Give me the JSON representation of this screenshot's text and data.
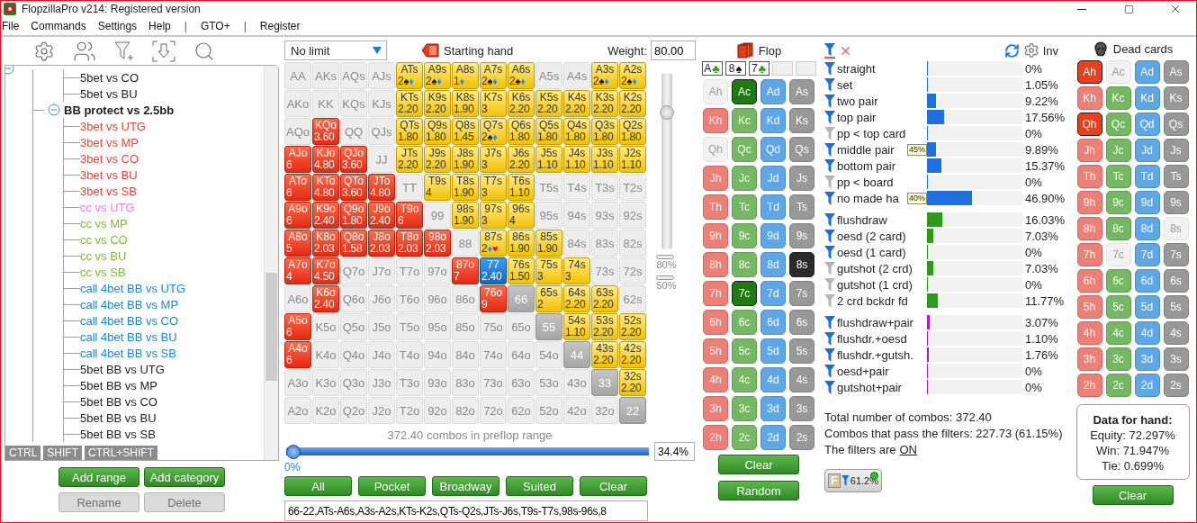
{
  "window": {
    "title": "FlopzillaPro v214: Registered version"
  },
  "menu": [
    {
      "label": "File",
      "kind": "item"
    },
    {
      "label": "Commands",
      "kind": "item"
    },
    {
      "label": "Settings",
      "kind": "item"
    },
    {
      "label": "Help",
      "kind": "item"
    },
    {
      "label": "|",
      "kind": "separator"
    },
    {
      "label": "GTO+",
      "kind": "item"
    },
    {
      "label": "|",
      "kind": "separator"
    },
    {
      "label": "Register",
      "kind": "item"
    }
  ],
  "tree": {
    "expanded": true,
    "items": [
      {
        "kind": "continued",
        "children": [
          {
            "label": "5bet vs CO",
            "color": "#222222"
          },
          {
            "label": "5bet vs BU",
            "color": "#222222"
          }
        ]
      },
      {
        "kind": "group",
        "label": "BB protect vs 2.5bb",
        "expanded": true,
        "children": [
          {
            "label": "3bet vs UTG",
            "color": "#e8453c"
          },
          {
            "label": "3bet vs MP",
            "color": "#e8453c"
          },
          {
            "label": "3bet vs CO",
            "color": "#e8453c"
          },
          {
            "label": "3bet vs BU",
            "color": "#e8453c"
          },
          {
            "label": "3bet vs SB",
            "color": "#e8453c"
          },
          {
            "label": "cc vs UTG",
            "color": "#f07df0"
          },
          {
            "label": "cc vs MP",
            "color": "#7dbb3c"
          },
          {
            "label": "cc vs CO",
            "color": "#7dbb3c"
          },
          {
            "label": "cc vs BU",
            "color": "#7dbb3c"
          },
          {
            "label": "cc vs SB",
            "color": "#7dbb3c"
          },
          {
            "label": "call 4bet BB vs UTG",
            "color": "#1d86d1"
          },
          {
            "label": "call 4bet BB vs MP",
            "color": "#1d86d1"
          },
          {
            "label": "call 4bet BB vs CO",
            "color": "#1d86d1"
          },
          {
            "label": "call 4bet BB vs BU",
            "color": "#1d86d1"
          },
          {
            "label": "call 4bet BB vs SB",
            "color": "#1d86d1"
          },
          {
            "label": "5bet BB vs UTG",
            "color": "#222222"
          },
          {
            "label": "5bet BB vs MP",
            "color": "#222222"
          },
          {
            "label": "5bet BB vs CO",
            "color": "#222222"
          },
          {
            "label": "5bet BB vs BU",
            "color": "#222222"
          },
          {
            "label": "5bet BB vs SB",
            "color": "#222222"
          }
        ]
      }
    ]
  },
  "modifier_keys": [
    "CTRL",
    "SHIFT",
    "CTRL+SHIFT"
  ],
  "range_buttons": [
    {
      "label": "Add range",
      "disabled": false
    },
    {
      "label": "Add category",
      "disabled": false
    },
    {
      "label": "Rename",
      "disabled": true
    },
    {
      "label": "Delete",
      "disabled": true
    }
  ],
  "range_editor": {
    "game_type": "No limit",
    "mode_label": "Starting hand",
    "weight_label": "Weight:",
    "weight": "80.00",
    "weight_slider": {
      "level": 0.8
    },
    "markers": [
      "80%",
      "50%"
    ],
    "grid": [
      [
        {
          "label": "AA",
          "kind": "empty"
        },
        {
          "label": "AKs",
          "kind": "empty"
        },
        {
          "label": "AQs",
          "kind": "empty"
        },
        {
          "label": "AJs",
          "kind": "empty"
        },
        {
          "label": "ATs",
          "kind": "suited",
          "value": "2",
          "suits": [
            {
              "symbol": "♠",
              "color": "#111111"
            },
            {
              "symbol": "♦",
              "color": "#1e90ff"
            }
          ]
        },
        {
          "label": "A9s",
          "kind": "suited",
          "value": "2",
          "suits": [
            {
              "symbol": "♠",
              "color": "#111111"
            },
            {
              "symbol": "♦",
              "color": "#1e90ff"
            }
          ]
        },
        {
          "label": "A8s",
          "kind": "suited",
          "value": "1",
          "suits": [
            {
              "symbol": "♦",
              "color": "#1e90ff"
            }
          ]
        },
        {
          "label": "A7s",
          "kind": "suited",
          "value": "2",
          "suits": [
            {
              "symbol": "♠",
              "color": "#111111"
            },
            {
              "symbol": "♦",
              "color": "#1e90ff"
            }
          ]
        },
        {
          "label": "A6s",
          "kind": "suited",
          "value": "2",
          "suits": [
            {
              "symbol": "♠",
              "color": "#111111"
            },
            {
              "symbol": "♦",
              "color": "#1e90ff"
            }
          ]
        },
        {
          "label": "A5s",
          "kind": "empty"
        },
        {
          "label": "A4s",
          "kind": "empty"
        },
        {
          "label": "A3s",
          "kind": "suited",
          "value": "2",
          "suits": [
            {
              "symbol": "♠",
              "color": "#111111"
            },
            {
              "symbol": "♦",
              "color": "#1e90ff"
            }
          ]
        },
        {
          "label": "A2s",
          "kind": "suited",
          "value": "2",
          "suits": [
            {
              "symbol": "♠",
              "color": "#111111"
            },
            {
              "symbol": "♦",
              "color": "#1e90ff"
            }
          ]
        }
      ],
      [
        {
          "label": "AKo",
          "kind": "empty"
        },
        {
          "label": "KK",
          "kind": "empty"
        },
        {
          "label": "KQs",
          "kind": "empty"
        },
        {
          "label": "KJs",
          "kind": "empty"
        },
        {
          "label": "KTs",
          "kind": "suited",
          "value": "2.20"
        },
        {
          "label": "K9s",
          "kind": "suited",
          "value": "2.20"
        },
        {
          "label": "K8s",
          "kind": "suited",
          "value": "1.90"
        },
        {
          "label": "K7s",
          "kind": "suited",
          "value": "3"
        },
        {
          "label": "K6s",
          "kind": "suited",
          "value": "2.20"
        },
        {
          "label": "K5s",
          "kind": "suited",
          "value": "2.20"
        },
        {
          "label": "K4s",
          "kind": "suited",
          "value": "2.20"
        },
        {
          "label": "K3s",
          "kind": "suited",
          "value": "2.20"
        },
        {
          "label": "K2s",
          "kind": "suited",
          "value": "2.20"
        }
      ],
      [
        {
          "label": "AQo",
          "kind": "empty"
        },
        {
          "label": "KQo",
          "kind": "offsuit",
          "value": "3.60"
        },
        {
          "label": "QQ",
          "kind": "empty"
        },
        {
          "label": "QJs",
          "kind": "empty"
        },
        {
          "label": "QTs",
          "kind": "suited",
          "value": "1.80"
        },
        {
          "label": "Q9s",
          "kind": "suited",
          "value": "1.80"
        },
        {
          "label": "Q8s",
          "kind": "suited",
          "value": "1.45"
        },
        {
          "label": "Q7s",
          "kind": "suited",
          "value": "2",
          "suits": [
            {
              "symbol": "♠",
              "color": "#111111"
            },
            {
              "symbol": "♦",
              "color": "#1e90ff"
            }
          ]
        },
        {
          "label": "Q6s",
          "kind": "suited",
          "value": "1.80"
        },
        {
          "label": "Q5s",
          "kind": "suited",
          "value": "1.80"
        },
        {
          "label": "Q4s",
          "kind": "suited",
          "value": "1.80"
        },
        {
          "label": "Q3s",
          "kind": "suited",
          "value": "1.80"
        },
        {
          "label": "Q2s",
          "kind": "suited",
          "value": "1.80"
        }
      ],
      [
        {
          "label": "AJo",
          "kind": "offsuit",
          "value": "6"
        },
        {
          "label": "KJo",
          "kind": "offsuit",
          "value": "4.80"
        },
        {
          "label": "QJo",
          "kind": "offsuit",
          "value": "3.60"
        },
        {
          "label": "JJ",
          "kind": "empty"
        },
        {
          "label": "JTs",
          "kind": "suited",
          "value": "2.20"
        },
        {
          "label": "J9s",
          "kind": "suited",
          "value": "2.20"
        },
        {
          "label": "J8s",
          "kind": "suited",
          "value": "1.90"
        },
        {
          "label": "J7s",
          "kind": "suited",
          "value": "3"
        },
        {
          "label": "J6s",
          "kind": "suited",
          "value": "2.20"
        },
        {
          "label": "J5s",
          "kind": "suited",
          "value": "1.10"
        },
        {
          "label": "J4s",
          "kind": "suited",
          "value": "1.10"
        },
        {
          "label": "J3s",
          "kind": "suited",
          "value": "1.10"
        },
        {
          "label": "J2s",
          "kind": "suited",
          "value": "1.10"
        }
      ],
      [
        {
          "label": "ATo",
          "kind": "offsuit",
          "value": "6"
        },
        {
          "label": "KTo",
          "kind": "offsuit",
          "value": "4.80"
        },
        {
          "label": "QTo",
          "kind": "offsuit",
          "value": "3.60"
        },
        {
          "label": "JTo",
          "kind": "offsuit",
          "value": "4.80"
        },
        {
          "label": "TT",
          "kind": "empty"
        },
        {
          "label": "T9s",
          "kind": "suited",
          "value": "4"
        },
        {
          "label": "T8s",
          "kind": "suited",
          "value": "1.90"
        },
        {
          "label": "T7s",
          "kind": "suited",
          "value": "3"
        },
        {
          "label": "T6s",
          "kind": "suited",
          "value": "1.10"
        },
        {
          "label": "T5s",
          "kind": "empty"
        },
        {
          "label": "T4s",
          "kind": "empty"
        },
        {
          "label": "T3s",
          "kind": "empty"
        },
        {
          "label": "T2s",
          "kind": "empty"
        }
      ],
      [
        {
          "label": "A9o",
          "kind": "offsuit",
          "value": "6"
        },
        {
          "label": "K9o",
          "kind": "offsuit",
          "value": "2.40"
        },
        {
          "label": "Q9o",
          "kind": "offsuit",
          "value": "1.80"
        },
        {
          "label": "J9o",
          "kind": "offsuit",
          "value": "2.40"
        },
        {
          "label": "T9o",
          "kind": "offsuit",
          "value": "6"
        },
        {
          "label": "99",
          "kind": "empty"
        },
        {
          "label": "98s",
          "kind": "suited",
          "value": "1.90"
        },
        {
          "label": "97s",
          "kind": "suited",
          "value": "3"
        },
        {
          "label": "96s",
          "kind": "suited",
          "value": "4"
        },
        {
          "label": "95s",
          "kind": "empty"
        },
        {
          "label": "94s",
          "kind": "empty"
        },
        {
          "label": "93s",
          "kind": "empty"
        },
        {
          "label": "92s",
          "kind": "empty"
        }
      ],
      [
        {
          "label": "A8o",
          "kind": "offsuit",
          "value": "5"
        },
        {
          "label": "K8o",
          "kind": "offsuit",
          "value": "2.03"
        },
        {
          "label": "Q8o",
          "kind": "offsuit",
          "value": "1.58"
        },
        {
          "label": "J8o",
          "kind": "offsuit",
          "value": "2.03"
        },
        {
          "label": "T8o",
          "kind": "offsuit",
          "value": "2.03"
        },
        {
          "label": "98o",
          "kind": "offsuit",
          "value": "2.03"
        },
        {
          "label": "88",
          "kind": "empty"
        },
        {
          "label": "87s",
          "kind": "suited",
          "value": "2",
          "suits": [
            {
              "symbol": "♦",
              "color": "#1e90ff"
            },
            {
              "symbol": "♥",
              "color": "#e01818"
            }
          ]
        },
        {
          "label": "86s",
          "kind": "suited",
          "value": "1.90"
        },
        {
          "label": "85s",
          "kind": "suited",
          "value": "1.90"
        },
        {
          "label": "84s",
          "kind": "empty"
        },
        {
          "label": "83s",
          "kind": "empty"
        },
        {
          "label": "82s",
          "kind": "empty"
        }
      ],
      [
        {
          "label": "A7o",
          "kind": "offsuit",
          "value": "4"
        },
        {
          "label": "K7o",
          "kind": "offsuit",
          "value": "4.50"
        },
        {
          "label": "Q7o",
          "kind": "empty"
        },
        {
          "label": "J7o",
          "kind": "empty"
        },
        {
          "label": "T7o",
          "kind": "empty"
        },
        {
          "label": "97o",
          "kind": "empty"
        },
        {
          "label": "87o",
          "kind": "offsuit",
          "value": "7"
        },
        {
          "label": "77",
          "kind": "selected",
          "value": "2.40"
        },
        {
          "label": "76s",
          "kind": "suited",
          "value": "1.50"
        },
        {
          "label": "75s",
          "kind": "suited",
          "value": "3"
        },
        {
          "label": "74s",
          "kind": "suited",
          "value": "3"
        },
        {
          "label": "73s",
          "kind": "empty"
        },
        {
          "label": "72s",
          "kind": "empty"
        }
      ],
      [
        {
          "label": "A6o",
          "kind": "empty"
        },
        {
          "label": "K6o",
          "kind": "offsuit",
          "value": "2.40"
        },
        {
          "label": "Q6o",
          "kind": "empty"
        },
        {
          "label": "J6o",
          "kind": "empty"
        },
        {
          "label": "T6o",
          "kind": "empty"
        },
        {
          "label": "96o",
          "kind": "empty"
        },
        {
          "label": "86o",
          "kind": "empty"
        },
        {
          "label": "76o",
          "kind": "offsuit",
          "value": "9"
        },
        {
          "label": "66",
          "kind": "pair"
        },
        {
          "label": "65s",
          "kind": "suited",
          "value": "2"
        },
        {
          "label": "64s",
          "kind": "suited",
          "value": "2.20"
        },
        {
          "label": "63s",
          "kind": "suited",
          "value": "2.20"
        },
        {
          "label": "62s",
          "kind": "empty"
        }
      ],
      [
        {
          "label": "A5o",
          "kind": "offsuit",
          "value": "6"
        },
        {
          "label": "K5o",
          "kind": "empty"
        },
        {
          "label": "Q5o",
          "kind": "empty"
        },
        {
          "label": "J5o",
          "kind": "empty"
        },
        {
          "label": "T5o",
          "kind": "empty"
        },
        {
          "label": "95o",
          "kind": "empty"
        },
        {
          "label": "85o",
          "kind": "empty"
        },
        {
          "label": "75o",
          "kind": "empty"
        },
        {
          "label": "65o",
          "kind": "empty"
        },
        {
          "label": "55",
          "kind": "pair"
        },
        {
          "label": "54s",
          "kind": "suited",
          "value": "1.10"
        },
        {
          "label": "53s",
          "kind": "suited",
          "value": "2.20"
        },
        {
          "label": "52s",
          "kind": "suited",
          "value": "2.20"
        }
      ],
      [
        {
          "label": "A4o",
          "kind": "offsuit",
          "value": "6"
        },
        {
          "label": "K4o",
          "kind": "empty"
        },
        {
          "label": "Q4o",
          "kind": "empty"
        },
        {
          "label": "J4o",
          "kind": "empty"
        },
        {
          "label": "T4o",
          "kind": "empty"
        },
        {
          "label": "94o",
          "kind": "empty"
        },
        {
          "label": "84o",
          "kind": "empty"
        },
        {
          "label": "74o",
          "kind": "empty"
        },
        {
          "label": "64o",
          "kind": "empty"
        },
        {
          "label": "54o",
          "kind": "empty"
        },
        {
          "label": "44",
          "kind": "pair"
        },
        {
          "label": "43s",
          "kind": "suited",
          "value": "2.20"
        },
        {
          "label": "42s",
          "kind": "suited",
          "value": "2.20"
        }
      ],
      [
        {
          "label": "A3o",
          "kind": "empty"
        },
        {
          "label": "K3o",
          "kind": "empty"
        },
        {
          "label": "Q3o",
          "kind": "empty"
        },
        {
          "label": "J3o",
          "kind": "empty"
        },
        {
          "label": "T3o",
          "kind": "empty"
        },
        {
          "label": "93o",
          "kind": "empty"
        },
        {
          "label": "83o",
          "kind": "empty"
        },
        {
          "label": "73o",
          "kind": "empty"
        },
        {
          "label": "63o",
          "kind": "empty"
        },
        {
          "label": "53o",
          "kind": "empty"
        },
        {
          "label": "43o",
          "kind": "empty"
        },
        {
          "label": "33",
          "kind": "pair"
        },
        {
          "label": "32s",
          "kind": "suited",
          "value": "2.20"
        }
      ],
      [
        {
          "label": "A2o",
          "kind": "empty"
        },
        {
          "label": "K2o",
          "kind": "empty"
        },
        {
          "label": "Q2o",
          "kind": "empty"
        },
        {
          "label": "J2o",
          "kind": "empty"
        },
        {
          "label": "T2o",
          "kind": "empty"
        },
        {
          "label": "92o",
          "kind": "empty"
        },
        {
          "label": "82o",
          "kind": "empty"
        },
        {
          "label": "72o",
          "kind": "empty"
        },
        {
          "label": "62o",
          "kind": "empty"
        },
        {
          "label": "52o",
          "kind": "empty"
        },
        {
          "label": "42o",
          "kind": "empty"
        },
        {
          "label": "32o",
          "kind": "empty"
        },
        {
          "label": "22",
          "kind": "pair"
        }
      ]
    ],
    "combos_text": "372.40 combos in preflop range",
    "range_slider": {
      "level": 0
    },
    "range_min_label": "0%",
    "range_percent": "34.4%",
    "buttons": [
      "All",
      "Pocket",
      "Broadway",
      "Suited",
      "Clear"
    ],
    "range_text": "66-22,ATs-A6s,A3s-A2s,KTs-K2s,QTs-Q2s,JTs-J6s,T9s-T7s,98s-96s,8"
  },
  "flop": {
    "title": "Flop",
    "slots": [
      {
        "rank": "A",
        "symbol": "♣",
        "color": "#2e9a1a",
        "filled": true
      },
      {
        "rank": "8",
        "symbol": "♠",
        "color": "#111111",
        "filled": true
      },
      {
        "rank": "7",
        "symbol": "♣",
        "color": "#2e9a1a",
        "filled": true
      },
      {
        "filled": false
      },
      {
        "filled": false
      }
    ],
    "cards": [
      [
        {
          "label": "Ah",
          "kind": "heart",
          "selected": false,
          "disabled": true
        },
        {
          "label": "Ac",
          "kind": "club",
          "selected": true,
          "disabled": false
        },
        {
          "label": "Ad",
          "kind": "diamond",
          "selected": false,
          "disabled": false
        },
        {
          "label": "As",
          "kind": "spade",
          "selected": false,
          "disabled": false
        }
      ],
      [
        {
          "label": "Kh",
          "kind": "heart",
          "selected": false,
          "disabled": false
        },
        {
          "label": "Kc",
          "kind": "club",
          "selected": false,
          "disabled": false
        },
        {
          "label": "Kd",
          "kind": "diamond",
          "selected": false,
          "disabled": false
        },
        {
          "label": "Ks",
          "kind": "spade",
          "selected": false,
          "disabled": false
        }
      ],
      [
        {
          "label": "Qh",
          "kind": "heart",
          "selected": false,
          "disabled": true
        },
        {
          "label": "Qc",
          "kind": "club",
          "selected": false,
          "disabled": false
        },
        {
          "label": "Qd",
          "kind": "diamond",
          "selected": false,
          "disabled": false
        },
        {
          "label": "Qs",
          "kind": "spade",
          "selected": false,
          "disabled": false
        }
      ],
      [
        {
          "label": "Jh",
          "kind": "heart",
          "selected": false,
          "disabled": false
        },
        {
          "label": "Jc",
          "kind": "club",
          "selected": false,
          "disabled": false
        },
        {
          "label": "Jd",
          "kind": "diamond",
          "selected": false,
          "disabled": false
        },
        {
          "label": "Js",
          "kind": "spade",
          "selected": false,
          "disabled": false
        }
      ],
      [
        {
          "label": "Th",
          "kind": "heart",
          "selected": false,
          "disabled": false
        },
        {
          "label": "Tc",
          "kind": "club",
          "selected": false,
          "disabled": false
        },
        {
          "label": "Td",
          "kind": "diamond",
          "selected": false,
          "disabled": false
        },
        {
          "label": "Ts",
          "kind": "spade",
          "selected": false,
          "disabled": false
        }
      ],
      [
        {
          "label": "9h",
          "kind": "heart",
          "selected": false,
          "disabled": false
        },
        {
          "label": "9c",
          "kind": "club",
          "selected": false,
          "disabled": false
        },
        {
          "label": "9d",
          "kind": "diamond",
          "selected": false,
          "disabled": false
        },
        {
          "label": "9s",
          "kind": "spade",
          "selected": false,
          "disabled": false
        }
      ],
      [
        {
          "label": "8h",
          "kind": "heart",
          "selected": false,
          "disabled": false
        },
        {
          "label": "8c",
          "kind": "club",
          "selected": false,
          "disabled": false
        },
        {
          "label": "8d",
          "kind": "diamond",
          "selected": false,
          "disabled": false
        },
        {
          "label": "8s",
          "kind": "spade",
          "selected": true,
          "disabled": false
        }
      ],
      [
        {
          "label": "7h",
          "kind": "heart",
          "selected": false,
          "disabled": false
        },
        {
          "label": "7c",
          "kind": "club",
          "selected": true,
          "disabled": false
        },
        {
          "label": "7d",
          "kind": "diamond",
          "selected": false,
          "disabled": false
        },
        {
          "label": "7s",
          "kind": "spade",
          "selected": false,
          "disabled": false
        }
      ],
      [
        {
          "label": "6h",
          "kind": "heart",
          "selected": false,
          "disabled": false
        },
        {
          "label": "6c",
          "kind": "club",
          "selected": false,
          "disabled": false
        },
        {
          "label": "6d",
          "kind": "diamond",
          "selected": false,
          "disabled": false
        },
        {
          "label": "6s",
          "kind": "spade",
          "selected": false,
          "disabled": false
        }
      ],
      [
        {
          "label": "5h",
          "kind": "heart",
          "selected": false,
          "disabled": false
        },
        {
          "label": "5c",
          "kind": "club",
          "selected": false,
          "disabled": false
        },
        {
          "label": "5d",
          "kind": "diamond",
          "selected": false,
          "disabled": false
        },
        {
          "label": "5s",
          "kind": "spade",
          "selected": false,
          "disabled": false
        }
      ],
      [
        {
          "label": "4h",
          "kind": "heart",
          "selected": false,
          "disabled": false
        },
        {
          "label": "4c",
          "kind": "club",
          "selected": false,
          "disabled": false
        },
        {
          "label": "4d",
          "kind": "diamond",
          "selected": false,
          "disabled": false
        },
        {
          "label": "4s",
          "kind": "spade",
          "selected": false,
          "disabled": false
        }
      ],
      [
        {
          "label": "3h",
          "kind": "heart",
          "selected": false,
          "disabled": false
        },
        {
          "label": "3c",
          "kind": "club",
          "selected": false,
          "disabled": false
        },
        {
          "label": "3d",
          "kind": "diamond",
          "selected": false,
          "disabled": false
        },
        {
          "label": "3s",
          "kind": "spade",
          "selected": false,
          "disabled": false
        }
      ],
      [
        {
          "label": "2h",
          "kind": "heart",
          "selected": false,
          "disabled": false
        },
        {
          "label": "2c",
          "kind": "club",
          "selected": false,
          "disabled": false
        },
        {
          "label": "2d",
          "kind": "diamond",
          "selected": false,
          "disabled": false
        },
        {
          "label": "2s",
          "kind": "spade",
          "selected": false,
          "disabled": false
        }
      ]
    ],
    "buttons": [
      "Clear",
      "Random"
    ]
  },
  "filters": {
    "inv_label": "Inv",
    "groups": [
      {
        "color": "#1f6fe0",
        "rows": [
          {
            "label": "straight",
            "active": true,
            "level": 0,
            "value": "0%"
          },
          {
            "label": "set",
            "active": true,
            "level": 0.0105,
            "value": "1.05%"
          },
          {
            "label": "two pair",
            "active": true,
            "level": 0.0922,
            "value": "9.22%"
          },
          {
            "label": "top pair",
            "active": true,
            "level": 0.1756,
            "value": "17.56%"
          },
          {
            "label": "pp < top card",
            "active": false,
            "level": 0,
            "value": "0%"
          },
          {
            "label": "middle pair",
            "active": true,
            "level": 0.0989,
            "value": "9.89%",
            "badge": "45%"
          },
          {
            "label": "bottom pair",
            "active": true,
            "level": 0.1537,
            "value": "15.37%"
          },
          {
            "label": "pp < board",
            "active": false,
            "level": 0,
            "value": "0%"
          },
          {
            "label": "no made ha",
            "active": true,
            "level": 0.469,
            "value": "46.90%",
            "badge": "40%"
          }
        ]
      },
      {
        "color": "#2e9a1a",
        "rows": [
          {
            "label": "flushdraw",
            "active": true,
            "level": 0.1603,
            "value": "16.03%"
          },
          {
            "label": "oesd (2 card)",
            "active": true,
            "level": 0.0703,
            "value": "7.03%"
          },
          {
            "label": "oesd (1 card)",
            "active": true,
            "level": 0,
            "value": "0%"
          },
          {
            "label": "gutshot (2 crd)",
            "active": false,
            "level": 0.0703,
            "value": "7.03%"
          },
          {
            "label": "gutshot (1 crd)",
            "active": false,
            "level": 0,
            "value": "0%"
          },
          {
            "label": "2 crd bckdr fd",
            "active": false,
            "level": 0.1177,
            "value": "11.77%"
          }
        ]
      },
      {
        "color": "#a020c0",
        "rows": [
          {
            "label": "flushdraw+pair",
            "active": true,
            "level": 0.0307,
            "value": "3.07%"
          },
          {
            "label": "flushdr.+oesd",
            "active": true,
            "level": 0.011,
            "value": "1.10%"
          },
          {
            "label": "flushdr.+gutsh.",
            "active": true,
            "level": 0.0176,
            "value": "1.76%"
          },
          {
            "label": "oesd+pair",
            "active": true,
            "level": 0,
            "value": "0%"
          },
          {
            "label": "gutshot+pair",
            "active": true,
            "level": 0,
            "value": "0%"
          }
        ]
      }
    ],
    "total": "Total number of combos: 372.40",
    "passing": "Combos that pass the filters: 227.73 (61.15%)",
    "status_text": "The filters are",
    "status_value": "ON",
    "badge": {
      "label": "F",
      "percent": "61.2%",
      "on": true
    }
  },
  "dead_cards": {
    "title": "Dead cards",
    "cards": [
      [
        {
          "label": "Ah",
          "kind": "heart",
          "selected": true,
          "disabled": false
        },
        {
          "label": "Ac",
          "kind": "club",
          "selected": false,
          "disabled": true
        },
        {
          "label": "Ad",
          "kind": "diamond",
          "selected": false,
          "disabled": false
        },
        {
          "label": "As",
          "kind": "spade",
          "selected": false,
          "disabled": false
        }
      ],
      [
        {
          "label": "Kh",
          "kind": "heart",
          "selected": false,
          "disabled": false
        },
        {
          "label": "Kc",
          "kind": "club",
          "selected": false,
          "disabled": false
        },
        {
          "label": "Kd",
          "kind": "diamond",
          "selected": false,
          "disabled": false
        },
        {
          "label": "Ks",
          "kind": "spade",
          "selected": false,
          "disabled": false
        }
      ],
      [
        {
          "label": "Qh",
          "kind": "heart",
          "selected": true,
          "disabled": false
        },
        {
          "label": "Qc",
          "kind": "club",
          "selected": false,
          "disabled": false
        },
        {
          "label": "Qd",
          "kind": "diamond",
          "selected": false,
          "disabled": false
        },
        {
          "label": "Qs",
          "kind": "spade",
          "selected": false,
          "disabled": false
        }
      ],
      [
        {
          "label": "Jh",
          "kind": "heart",
          "selected": false,
          "disabled": false
        },
        {
          "label": "Jc",
          "kind": "club",
          "selected": false,
          "disabled": false
        },
        {
          "label": "Jd",
          "kind": "diamond",
          "selected": false,
          "disabled": false
        },
        {
          "label": "Js",
          "kind": "spade",
          "selected": false,
          "disabled": false
        }
      ],
      [
        {
          "label": "Th",
          "kind": "heart",
          "selected": false,
          "disabled": false
        },
        {
          "label": "Tc",
          "kind": "club",
          "selected": false,
          "disabled": false
        },
        {
          "label": "Td",
          "kind": "diamond",
          "selected": false,
          "disabled": false
        },
        {
          "label": "Ts",
          "kind": "spade",
          "selected": false,
          "disabled": false
        }
      ],
      [
        {
          "label": "9h",
          "kind": "heart",
          "selected": false,
          "disabled": false
        },
        {
          "label": "9c",
          "kind": "club",
          "selected": false,
          "disabled": false
        },
        {
          "label": "9d",
          "kind": "diamond",
          "selected": false,
          "disabled": false
        },
        {
          "label": "9s",
          "kind": "spade",
          "selected": false,
          "disabled": false
        }
      ],
      [
        {
          "label": "8h",
          "kind": "heart",
          "selected": false,
          "disabled": false
        },
        {
          "label": "8c",
          "kind": "club",
          "selected": false,
          "disabled": false
        },
        {
          "label": "8d",
          "kind": "diamond",
          "selected": false,
          "disabled": false
        },
        {
          "label": "8s",
          "kind": "spade",
          "selected": false,
          "disabled": true
        }
      ],
      [
        {
          "label": "7h",
          "kind": "heart",
          "selected": false,
          "disabled": false
        },
        {
          "label": "7c",
          "kind": "club",
          "selected": false,
          "disabled": true
        },
        {
          "label": "7d",
          "kind": "diamond",
          "selected": false,
          "disabled": false
        },
        {
          "label": "7s",
          "kind": "spade",
          "selected": false,
          "disabled": false
        }
      ],
      [
        {
          "label": "6h",
          "kind": "heart",
          "selected": false,
          "disabled": false
        },
        {
          "label": "6c",
          "kind": "club",
          "selected": false,
          "disabled": false
        },
        {
          "label": "6d",
          "kind": "diamond",
          "selected": false,
          "disabled": false
        },
        {
          "label": "6s",
          "kind": "spade",
          "selected": false,
          "disabled": false
        }
      ],
      [
        {
          "label": "5h",
          "kind": "heart",
          "selected": false,
          "disabled": false
        },
        {
          "label": "5c",
          "kind": "club",
          "selected": false,
          "disabled": false
        },
        {
          "label": "5d",
          "kind": "diamond",
          "selected": false,
          "disabled": false
        },
        {
          "label": "5s",
          "kind": "spade",
          "selected": false,
          "disabled": false
        }
      ],
      [
        {
          "label": "4h",
          "kind": "heart",
          "selected": false,
          "disabled": false
        },
        {
          "label": "4c",
          "kind": "club",
          "selected": false,
          "disabled": false
        },
        {
          "label": "4d",
          "kind": "diamond",
          "selected": false,
          "disabled": false
        },
        {
          "label": "4s",
          "kind": "spade",
          "selected": false,
          "disabled": false
        }
      ],
      [
        {
          "label": "3h",
          "kind": "heart",
          "selected": false,
          "disabled": false
        },
        {
          "label": "3c",
          "kind": "club",
          "selected": false,
          "disabled": false
        },
        {
          "label": "3d",
          "kind": "diamond",
          "selected": false,
          "disabled": false
        },
        {
          "label": "3s",
          "kind": "spade",
          "selected": false,
          "disabled": false
        }
      ],
      [
        {
          "label": "2h",
          "kind": "heart",
          "selected": false,
          "disabled": false
        },
        {
          "label": "2c",
          "kind": "club",
          "selected": false,
          "disabled": false
        },
        {
          "label": "2d",
          "kind": "diamond",
          "selected": false,
          "disabled": false
        },
        {
          "label": "2s",
          "kind": "spade",
          "selected": false,
          "disabled": false
        }
      ]
    ],
    "hand_data": {
      "title": "Data for hand:",
      "lines": [
        "Equity: 72.297%",
        "Win: 71.947%",
        "Tie: 0.699%"
      ]
    },
    "button": "Clear"
  }
}
